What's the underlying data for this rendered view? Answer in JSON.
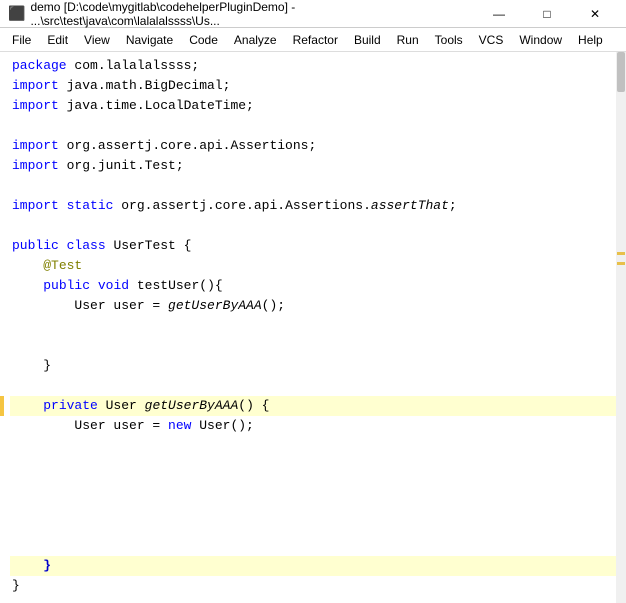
{
  "titlebar": {
    "icon": "▶",
    "text": "demo [D:\\code\\mygitlab\\codehelperPluginDemo] - ...\\src\\test\\java\\com\\lalalalssss\\Us...",
    "minimize": "—",
    "maximize": "□",
    "close": "✕"
  },
  "menubar": {
    "items": [
      "File",
      "Edit",
      "View",
      "Navigate",
      "Code",
      "Analyze",
      "Refactor",
      "Build",
      "Run",
      "Tools",
      "VCS",
      "Window",
      "Help"
    ]
  },
  "code": {
    "lines": [
      {
        "id": 1,
        "text": "package com.lalalalssss;",
        "highlight": ""
      },
      {
        "id": 2,
        "text": "import java.math.BigDecimal;",
        "highlight": ""
      },
      {
        "id": 3,
        "text": "import java.time.LocalDateTime;",
        "highlight": ""
      },
      {
        "id": 4,
        "text": "",
        "highlight": ""
      },
      {
        "id": 5,
        "text": "import org.assertj.core.api.Assertions;",
        "highlight": ""
      },
      {
        "id": 6,
        "text": "import org.junit.Test;",
        "highlight": ""
      },
      {
        "id": 7,
        "text": "",
        "highlight": ""
      },
      {
        "id": 8,
        "text": "import static org.assertj.core.api.Assertions.assertThat;",
        "highlight": ""
      },
      {
        "id": 9,
        "text": "",
        "highlight": ""
      },
      {
        "id": 10,
        "text": "public class UserTest {",
        "highlight": ""
      },
      {
        "id": 11,
        "text": "    @Test",
        "highlight": ""
      },
      {
        "id": 12,
        "text": "    public void testUser(){",
        "highlight": ""
      },
      {
        "id": 13,
        "text": "        User user = getUserByAAA();",
        "highlight": ""
      },
      {
        "id": 14,
        "text": "",
        "highlight": ""
      },
      {
        "id": 15,
        "text": "",
        "highlight": ""
      },
      {
        "id": 16,
        "text": "    }",
        "highlight": ""
      },
      {
        "id": 17,
        "text": "",
        "highlight": ""
      },
      {
        "id": 18,
        "text": "    private User getUserByAAA() {",
        "highlight": "yellow"
      },
      {
        "id": 19,
        "text": "        User user = new User();",
        "highlight": ""
      },
      {
        "id": 20,
        "text": "",
        "highlight": ""
      },
      {
        "id": 21,
        "text": "",
        "highlight": ""
      },
      {
        "id": 22,
        "text": "",
        "highlight": ""
      },
      {
        "id": 23,
        "text": "",
        "highlight": ""
      },
      {
        "id": 24,
        "text": "",
        "highlight": ""
      },
      {
        "id": 25,
        "text": "",
        "highlight": ""
      },
      {
        "id": 26,
        "text": "    }",
        "highlight": ""
      },
      {
        "id": 27,
        "text": "}",
        "highlight": ""
      }
    ]
  }
}
